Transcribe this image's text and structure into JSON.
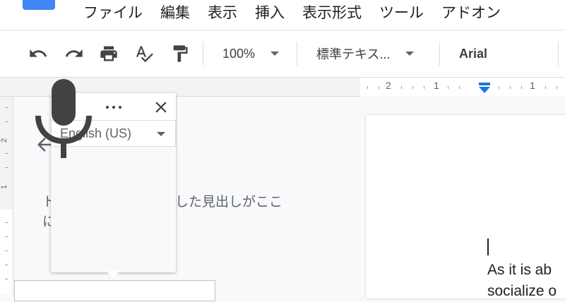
{
  "menu": {
    "items": [
      "ファイル",
      "編集",
      "表示",
      "挿入",
      "表示形式",
      "ツール",
      "アドオン"
    ]
  },
  "toolbar": {
    "undo_icon": "undo-icon",
    "redo_icon": "redo-icon",
    "print_icon": "print-icon",
    "spellcheck_icon": "spellcheck-icon",
    "paint_format_icon": "paint-format-icon",
    "zoom": "100%",
    "style": "標準テキス...",
    "font": "Arial"
  },
  "ruler": {
    "labels": [
      "2",
      "1",
      "1"
    ]
  },
  "vertical_ruler": {
    "labels": [
      "2",
      "1"
    ]
  },
  "outline": {
    "text_line1": "ト",
    "text_line1_right": "加した見出しがここ",
    "text_line2": "に"
  },
  "voice_typing": {
    "language": "English (US)",
    "mic_icon": "microphone-icon"
  },
  "document": {
    "line1": "As it is ab",
    "line2": "socialize o"
  },
  "colors": {
    "brand_blue": "#4285f4",
    "indent_marker": "#1a73e8"
  }
}
